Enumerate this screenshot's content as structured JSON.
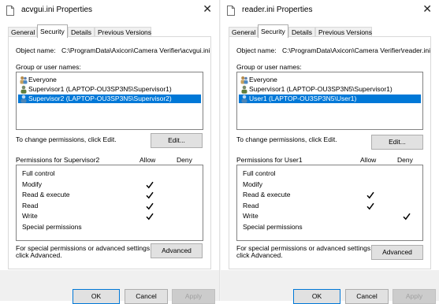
{
  "left_dialog": {
    "title": "acvgui.ini Properties",
    "tabs": [
      "General",
      "Security",
      "Details",
      "Previous Versions"
    ],
    "object_name_label": "Object name:",
    "object_name_value": "C:\\ProgramData\\Axicon\\Camera Verifier\\acvgui.ini",
    "group_label": "Group or user names:",
    "users": [
      {
        "name": "Everyone",
        "icon": "group-icon",
        "selected": false
      },
      {
        "name": "Supervisor1 (LAPTOP-OU3SP3N5\\Supervisor1)",
        "icon": "user-icon",
        "selected": false
      },
      {
        "name": "Supervisor2 (LAPTOP-OU3SP3N5\\Supervisor2)",
        "icon": "user-icon",
        "selected": true
      }
    ],
    "change_text": "To change permissions, click Edit.",
    "edit_label": "Edit...",
    "permissions_for": "Permissions for Supervisor2",
    "allow_label": "Allow",
    "deny_label": "Deny",
    "permissions": [
      {
        "name": "Full control",
        "allow": false,
        "deny": false
      },
      {
        "name": "Modify",
        "allow": true,
        "deny": false
      },
      {
        "name": "Read & execute",
        "allow": true,
        "deny": false
      },
      {
        "name": "Read",
        "allow": true,
        "deny": false
      },
      {
        "name": "Write",
        "allow": true,
        "deny": false
      },
      {
        "name": "Special permissions",
        "allow": false,
        "deny": false
      }
    ],
    "special_text_1": "For special permissions or advanced settings,",
    "special_text_2": "click Advanced.",
    "advanced_label": "Advanced",
    "ok_label": "OK",
    "cancel_label": "Cancel",
    "apply_label": "Apply"
  },
  "right_dialog": {
    "title": "reader.ini Properties",
    "tabs": [
      "General",
      "Security",
      "Details",
      "Previous Versions"
    ],
    "object_name_label": "Object name:",
    "object_name_value": "C:\\ProgramData\\Axicon\\Camera Verifier\\reader.ini",
    "group_label": "Group or user names:",
    "users": [
      {
        "name": "Everyone",
        "icon": "group-icon",
        "selected": false
      },
      {
        "name": "Supervisor1 (LAPTOP-OU3SP3N5\\Supervisor1)",
        "icon": "user-icon",
        "selected": false
      },
      {
        "name": "User1 (LAPTOP-OU3SP3N5\\User1)",
        "icon": "user-icon",
        "selected": true
      }
    ],
    "change_text": "To change permissions, click Edit.",
    "edit_label": "Edit...",
    "permissions_for": "Permissions for User1",
    "allow_label": "Allow",
    "deny_label": "Deny",
    "permissions": [
      {
        "name": "Full control",
        "allow": false,
        "deny": false
      },
      {
        "name": "Modify",
        "allow": false,
        "deny": false
      },
      {
        "name": "Read & execute",
        "allow": true,
        "deny": false
      },
      {
        "name": "Read",
        "allow": true,
        "deny": false
      },
      {
        "name": "Write",
        "allow": false,
        "deny": true
      },
      {
        "name": "Special permissions",
        "allow": false,
        "deny": false
      }
    ],
    "special_text_1": "For special permissions or advanced settings,",
    "special_text_2": "click Advanced.",
    "advanced_label": "Advanced",
    "ok_label": "OK",
    "cancel_label": "Cancel",
    "apply_label": "Apply"
  },
  "colors": {
    "selection": "#0078d7",
    "check": "#000000"
  }
}
